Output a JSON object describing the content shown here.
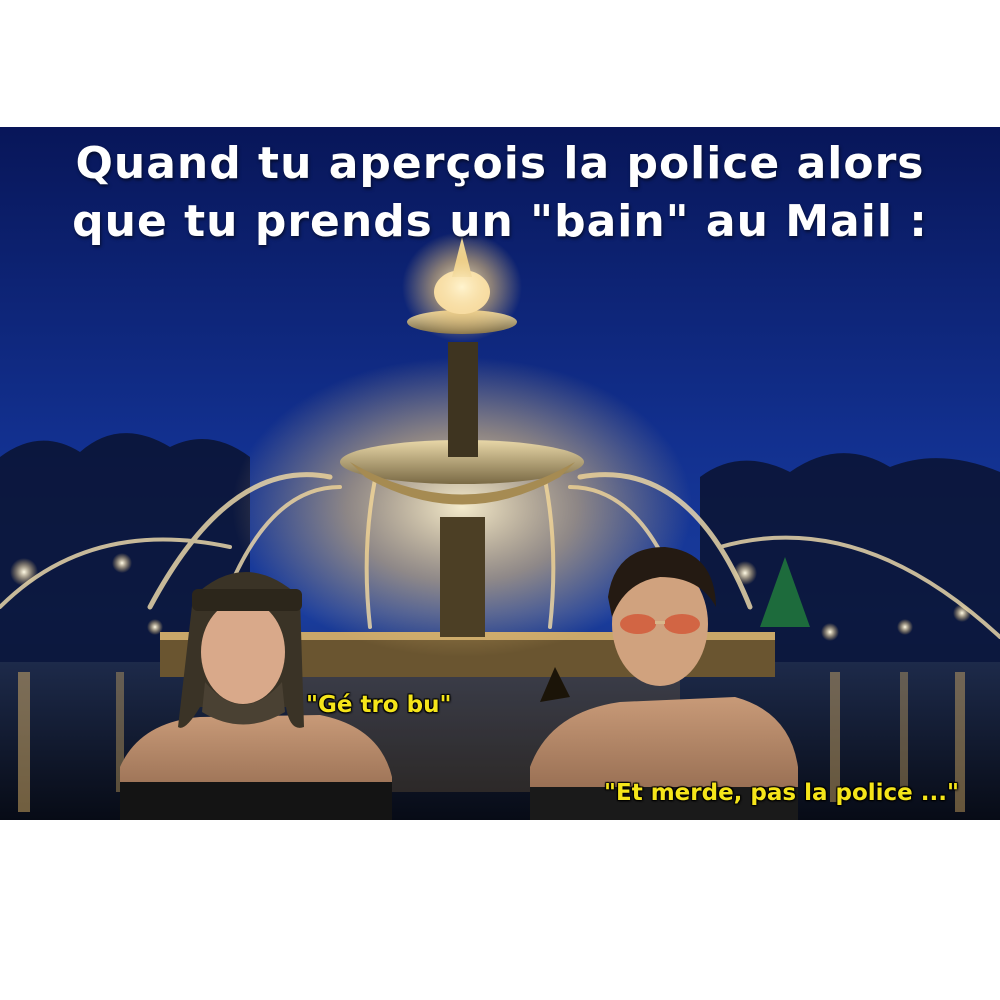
{
  "meme": {
    "title_line1": "Quand tu aperçois la police alors",
    "title_line2": "que tu prends un \"bain\" au Mail :",
    "caption_left": "\"Gé tro bu\"",
    "caption_right": "\"Et merde, pas la police ...\""
  },
  "colors": {
    "sky": "#0f2a86",
    "title_text": "#ffffff",
    "caption_text": "#f5e51a",
    "fountain_light": "#f3d79a"
  },
  "scene_elements": {
    "background": "illuminated-fountain-at-night",
    "left_person": "man-with-hat-and-beard",
    "right_person": "man-with-sunglasses"
  }
}
